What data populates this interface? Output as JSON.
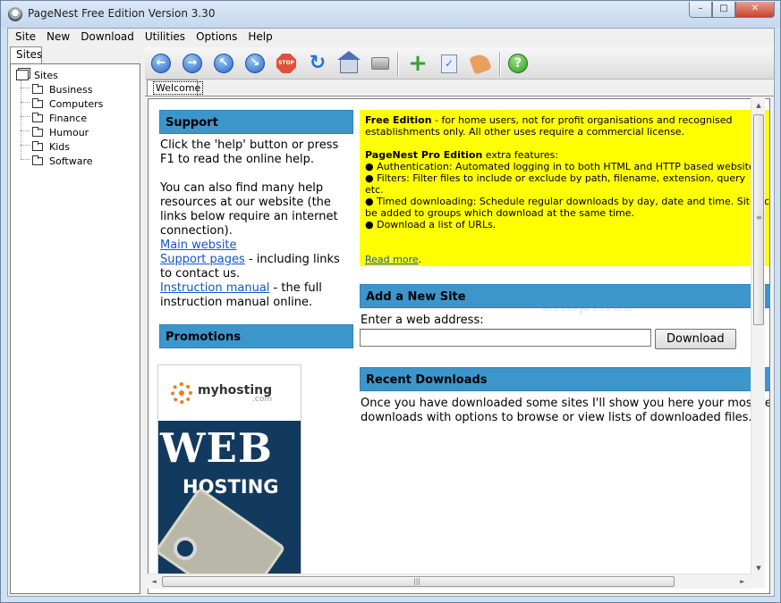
{
  "window": {
    "title": "PageNest Free Edition Version 3.30",
    "controls": [
      "–",
      "□",
      "✕"
    ]
  },
  "menubar": [
    "Site",
    "New",
    "Download",
    "Utilities",
    "Options",
    "Help"
  ],
  "left_panel": {
    "tab": "Sites",
    "root": "Sites",
    "items": [
      "Business",
      "Computers",
      "Finance",
      "Humour",
      "Kids",
      "Software"
    ]
  },
  "toolbar": {
    "icons": [
      "back-icon",
      "forward-icon",
      "up-icon",
      "down-icon",
      "stop-icon",
      "refresh-icon",
      "home-icon",
      "print-icon",
      "add-site-icon",
      "check-icon",
      "hand-icon",
      "help-icon"
    ],
    "stop_label": "STOP",
    "help_label": "?"
  },
  "content_tab": "Welcome",
  "support": {
    "heading": "Support",
    "p1": "Click the 'help' button or press F1 to read the online help.",
    "p2": "You can also find many help resources at our website (the links below require an internet connection).",
    "main_link": "Main website",
    "support_link": "Support pages",
    "support_suffix": " - including links to contact us.",
    "manual_link": "Instruction manual",
    "manual_suffix": " - the full instruction manual online."
  },
  "promotions": {
    "heading": "Promotions",
    "ad_brand": "myhosting",
    "ad_brand_sub": ".com",
    "ad_line1": "WEB",
    "ad_line2": "HOSTING"
  },
  "edition": {
    "free_title": "Free Edition",
    "free_text": " - for home users, not for profit organisations and recognised",
    "free_text2": "establishments only. All other uses require a commercial license.",
    "pro_title": "PageNest Pro Edition",
    "pro_suffix": " extra features:",
    "f1": "●  Authentication: Automated logging in to both HTML and HTTP based websites.",
    "f2": "●  Filters: Filter files to include or exclude by path, filename, extension, query",
    "f2b": "etc.",
    "f3": "●  Timed downloading: Schedule regular downloads by day, date and time. Sites can",
    "f3b": "be added to groups which download at the same time.",
    "f4": "●  Download a list of URLs.",
    "read_more": "Read more",
    "read_more_suffix": "."
  },
  "add_site": {
    "heading": "Add a New Site",
    "label": "Enter a web address:",
    "url_value": "",
    "button": "Download"
  },
  "recent": {
    "heading": "Recent Downloads",
    "line1": "Once you have downloaded some sites I'll show you here your most recent",
    "line2": "downloads with options to browse or view lists of downloaded files."
  },
  "scrollbars": {
    "up": "▲",
    "down": "▼",
    "left": "◄",
    "right": "►",
    "grip_v": "≡",
    "grip_h": "|||"
  },
  "watermark": "Snapfiles",
  "colors": {
    "section_head": "#3c96cc",
    "edition_box": "#ffff00",
    "link": "#1155cc"
  }
}
